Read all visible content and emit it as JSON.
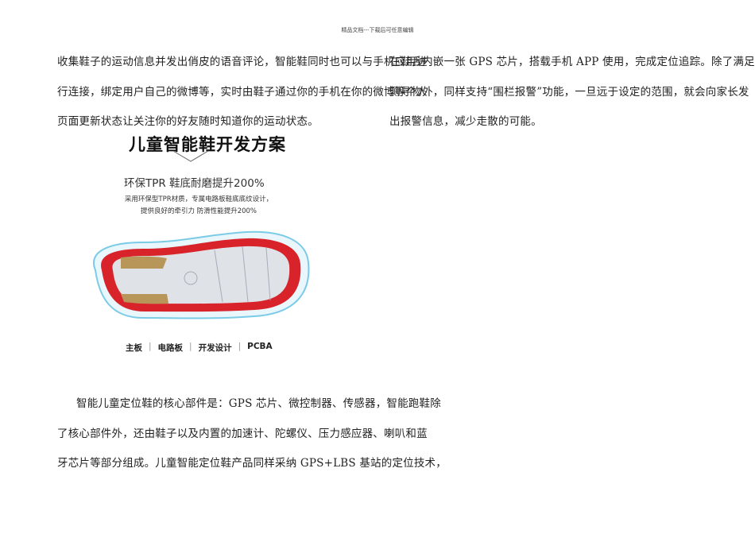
{
  "header": "精品文档---下载后可任意编辑",
  "left_column": {
    "top_lines": [
      "收集鞋子的运动信息并发出俏皮的语音评论，智能鞋同时也可以与手机应用进",
      "行连接，绑定用户自己的微博等，实时由鞋子通过你的手机在你的微博等个人",
      "页面更新状态让关注你的好友随时知道你的运动状态。"
    ],
    "bottom_lines": [
      "智能儿童定位鞋的核心部件是：GPS 芯片、微控制器、传感器，智能跑鞋除",
      "了核心部件外，还由鞋子以及内置的加速计、陀螺仪、压力感应器、喇叭和蓝",
      "牙芯片等部分组成。儿童智能定位鞋产品同样采纳 GPS+LBS 基站的定位技术，"
    ]
  },
  "right_column": {
    "lines": [
      "在鞋舌内嵌一张 GPS 芯片，搭载手机 APP 使用，完成定位追踪。除了满足主动探",
      "测寻物外，同样支持“围栏报警”功能，一旦远于设定的范围，就会向家长发",
      "出报警信息，减少走散的可能。"
    ]
  },
  "figure": {
    "title": "儿童智能鞋开发方案",
    "subtitle": "环保TPR 鞋底耐磨提升200%",
    "desc1": "采用环保型TPR材质，专属电路板鞋底底纹设计，",
    "desc2": "提供良好的牵引力 防滑性能提升200%",
    "labels": [
      "主板",
      "电路板",
      "开发设计",
      "PCBA"
    ]
  }
}
